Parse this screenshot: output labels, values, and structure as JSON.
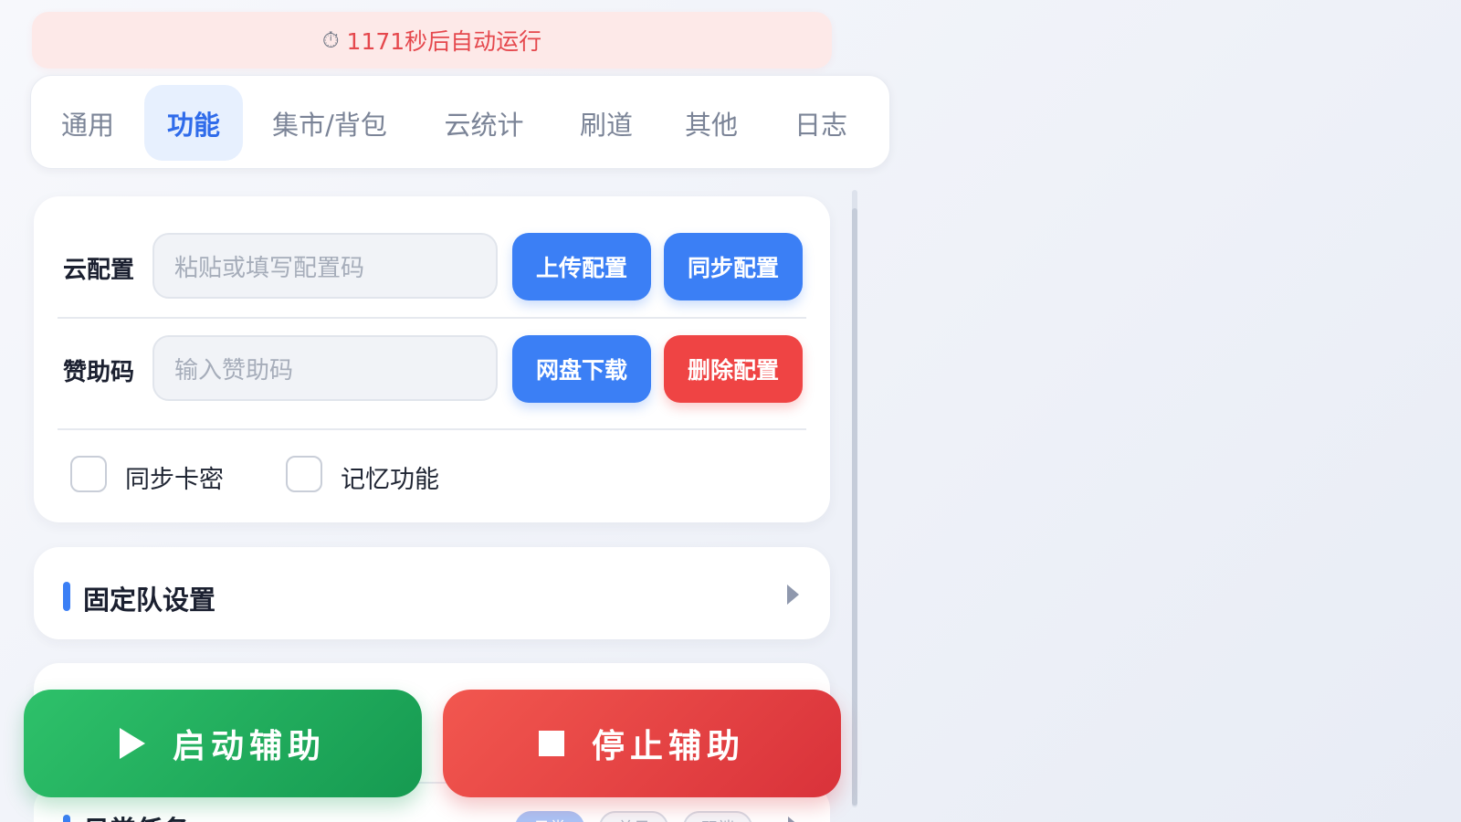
{
  "banner": {
    "icon": "stopwatch-icon",
    "text": "1171秒后自动运行"
  },
  "tabs": [
    {
      "label": "通用",
      "active": false
    },
    {
      "label": "功能",
      "active": true
    },
    {
      "label": "集市/背包",
      "active": false
    },
    {
      "label": "云统计",
      "active": false
    },
    {
      "label": "刷道",
      "active": false
    },
    {
      "label": "其他",
      "active": false
    },
    {
      "label": "日志",
      "active": false
    }
  ],
  "cloud_config": {
    "label": "云配置",
    "placeholder": "粘贴或填写配置码",
    "upload_label": "上传配置",
    "sync_label": "同步配置"
  },
  "sponsor": {
    "label": "赞助码",
    "placeholder": "输入赞助码",
    "download_label": "网盘下载",
    "delete_label": "删除配置"
  },
  "options": {
    "sync_card": {
      "label": "同步卡密",
      "checked": false
    },
    "memory": {
      "label": "记忆功能",
      "checked": false
    }
  },
  "sections": {
    "fixed_team": {
      "title": "固定队设置"
    },
    "daily_tasks": {
      "title": "日常任务",
      "pills": [
        "日常",
        "单日",
        "双端"
      ]
    }
  },
  "actions": {
    "start_label": "启动辅助",
    "stop_label": "停止辅助"
  },
  "colors": {
    "accent_blue": "#3b7ff5",
    "danger_red": "#ef4444",
    "start_green": "#1fae5e",
    "banner_bg": "#fde9e8",
    "banner_text": "#e5484d"
  }
}
